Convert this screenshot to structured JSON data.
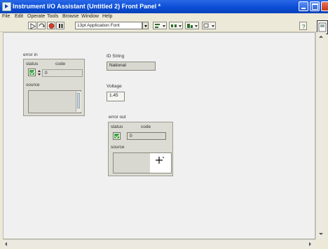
{
  "window": {
    "title": "Instrument I/O Assistant (Untitled 2) Front Panel *"
  },
  "menu": [
    "File",
    "Edit",
    "Operate",
    "Tools",
    "Browse",
    "Window",
    "Help"
  ],
  "toolbar": {
    "font": "13pt Application Font"
  },
  "error_in": {
    "label": "error in",
    "status_label": "status",
    "code_label": "code",
    "code_value": "0",
    "source_label": "source"
  },
  "id_string": {
    "label": "ID String",
    "value": "National"
  },
  "voltage": {
    "label": "Voltage",
    "value": "1.45"
  },
  "error_out": {
    "label": "error out",
    "status_label": "status",
    "code_label": "code",
    "code_value": "0",
    "source_label": "source"
  },
  "colors": {
    "title_bar": "#0b4ed6",
    "panel": "#f0f0f0",
    "status_green": "#3fa53f"
  }
}
